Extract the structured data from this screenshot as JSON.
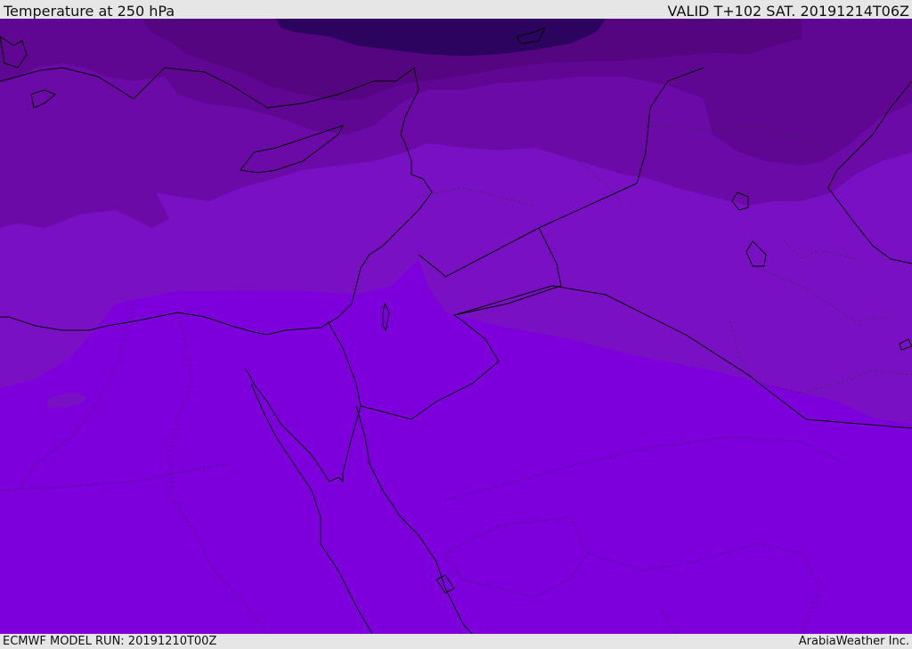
{
  "header": {
    "title": "Temperature at 250 hPa",
    "valid": "VALID T+102 SAT. 20191214T06Z"
  },
  "footer": {
    "model_run": "ECMWF MODEL RUN: 20191210T00Z",
    "credit": "ArabiaWeather Inc."
  },
  "map": {
    "variable": "Temperature at 250 hPa",
    "colors": {
      "warmest_band": "#7d00dc",
      "band_2": "#7a10c4",
      "band_3": "#6c0aa8",
      "band_4": "#5f0692",
      "band_5": "#55057f",
      "coldest_band": "#2c0460",
      "coastline": "#000000"
    }
  }
}
